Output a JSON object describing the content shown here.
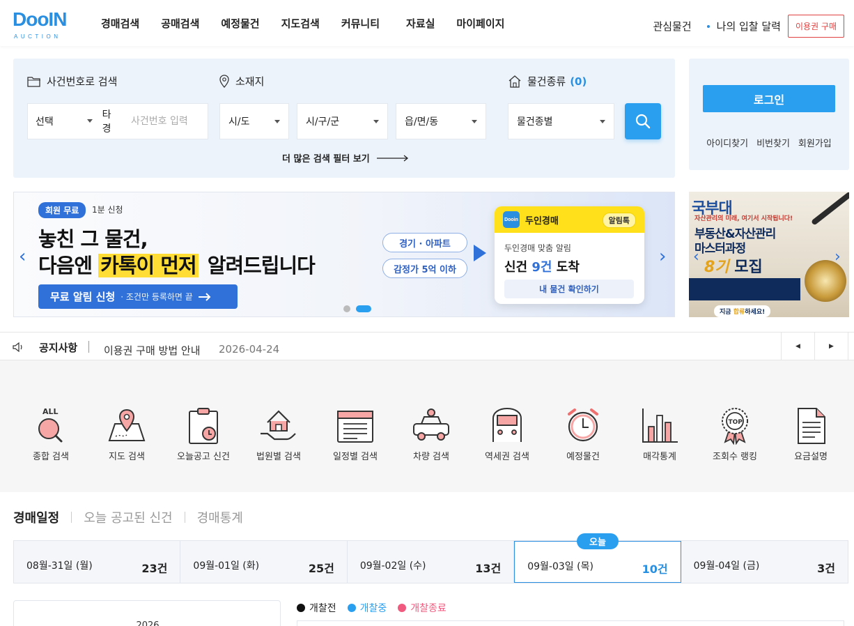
{
  "header": {
    "logo_text": "DooIN",
    "logo_sub": "AUCTION",
    "nav": [
      "경매검색",
      "공매검색",
      "예정물건",
      "지도검색",
      "커뮤니티",
      "자료실",
      "마이페이지"
    ],
    "watch": "관심물건",
    "my_bid": "나의 입찰 달력",
    "buy": "이용권 구매"
  },
  "search": {
    "case_label": "사건번호로 검색",
    "location_label": "소재지",
    "type_label": "물건종류",
    "type_count": "(0)",
    "case_select": "선택",
    "case_prefix": "타경",
    "case_placeholder": "사건번호 입력",
    "sido": "시/도",
    "sigungu": "시/구/군",
    "eupmyeon": "읍/면/동",
    "item_type": "물건종별",
    "more_filter": "더 많은 검색 필터 보기"
  },
  "login": {
    "button": "로그인",
    "links": [
      "아이디찾기",
      "비번찾기",
      "회원가입"
    ]
  },
  "banner": {
    "badge": "회원 무료",
    "badge_note": "1분 신청",
    "headline1": "놓친 그 물건,",
    "headline2_pre": "다음엔",
    "headline2_hl": "카톡이 먼저",
    "headline2_post": "알려드립니다",
    "cta_main": "무료 알림 신청",
    "cta_note": "· 조건만 등록하면 끝",
    "tag1": "경기 · 아파트",
    "tag2": "감정가 5억 이하",
    "card_logo": "Dooin",
    "card_title": "두인경매",
    "card_pill": "알림톡",
    "card_sub": "두인경매 맞춤 알림",
    "card_big_pre": "신건",
    "card_big_num": "9건",
    "card_big_post": "도착",
    "card_btn": "내 물건 확인하기",
    "prev": "‹",
    "next": "›"
  },
  "ad": {
    "brand": "국부대",
    "sub": "자산관리의 미래, 여기서 시작됩니다!",
    "line1": "부동산&자산관리",
    "line2": "마스터과정",
    "line3_num": "8기",
    "line3_post": "모집",
    "foot_pre": "지금",
    "foot_hl": "합류",
    "foot_post": "하세요!"
  },
  "notice": {
    "title": "공지사항",
    "text": "이용권 구매 방법 안내",
    "date": "2026-04-24",
    "prev": "◀",
    "next": "▶"
  },
  "quick_icons": [
    {
      "label": "종합 검색",
      "icon": "all-search-icon"
    },
    {
      "label": "지도 검색",
      "icon": "map-icon"
    },
    {
      "label": "오늘공고 신건",
      "icon": "clipboard-clock-icon"
    },
    {
      "label": "법원별 검색",
      "icon": "house-hand-icon"
    },
    {
      "label": "일정별 검색",
      "icon": "calendar-icon"
    },
    {
      "label": "차량 검색",
      "icon": "car-icon"
    },
    {
      "label": "역세권 검색",
      "icon": "train-icon"
    },
    {
      "label": "예정물건",
      "icon": "alarm-clock-icon"
    },
    {
      "label": "매각통계",
      "icon": "bar-chart-icon"
    },
    {
      "label": "조회수 랭킹",
      "icon": "top-badge-icon"
    },
    {
      "label": "요금설명",
      "icon": "document-icon"
    }
  ],
  "schedule": {
    "tabs": [
      "경매일정",
      "오늘 공고된 신건",
      "경매통계"
    ],
    "today_badge": "오늘",
    "days": [
      {
        "date": "08월-31일 (월)",
        "count": "23건"
      },
      {
        "date": "09월-01일 (화)",
        "count": "25건"
      },
      {
        "date": "09월-02일 (수)",
        "count": "13건"
      },
      {
        "date": "09월-03일 (목)",
        "count": "10건"
      },
      {
        "date": "09월-04일 (금)",
        "count": "3건"
      }
    ],
    "calendar_year": "2026",
    "legend": [
      {
        "label": "개찰전",
        "color": "#111111"
      },
      {
        "label": "개찰중",
        "color": "#2a9ff0"
      },
      {
        "label": "개찰종료",
        "color": "#f05a7e"
      }
    ]
  },
  "colors": {
    "primary": "#2a9ff0",
    "brand": "#2a8fe0",
    "accent_red": "#e0403f",
    "highlight": "#ffdd35"
  }
}
